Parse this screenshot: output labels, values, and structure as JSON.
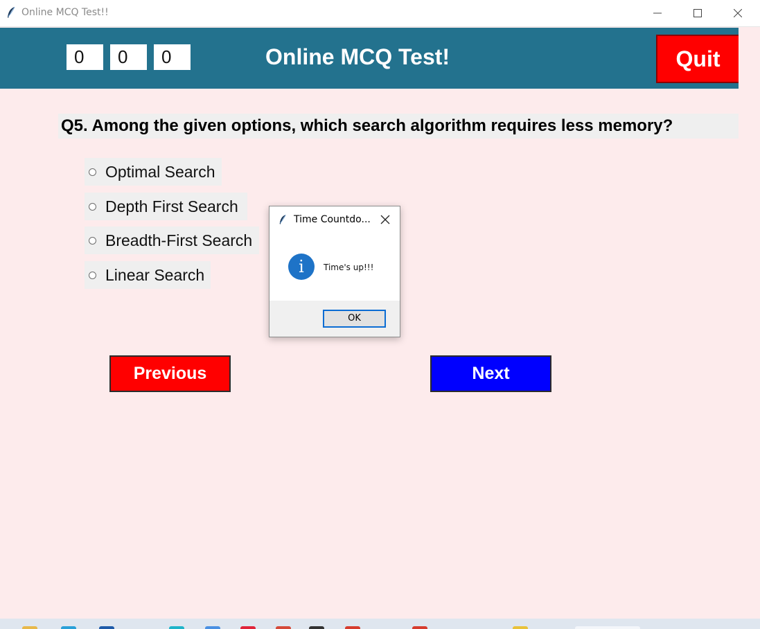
{
  "window": {
    "title": "Online MCQ Test!!"
  },
  "header": {
    "timer": [
      "0",
      "0",
      "0"
    ],
    "title": "Online MCQ Test!",
    "quit_label": "Quit"
  },
  "question": {
    "text": "Q5. Among the given options, which search algorithm requires less memory?",
    "options": [
      "Optimal Search",
      "Depth First Search",
      "Breadth-First Search",
      "Linear Search"
    ]
  },
  "nav": {
    "previous_label": "Previous",
    "next_label": "Next"
  },
  "dialog": {
    "title": "Time Countdo...",
    "message": "Time's up!!!",
    "ok_label": "OK"
  },
  "colors": {
    "header_bg": "#23728e",
    "page_bg": "#fdebec",
    "quit": "#ff0000",
    "previous": "#ff0000",
    "next": "#0000ff",
    "info": "#1e73c7"
  },
  "icons": [
    "feather-icon",
    "minimize-icon",
    "maximize-icon",
    "close-icon",
    "info-icon",
    "dialog-close-icon"
  ]
}
